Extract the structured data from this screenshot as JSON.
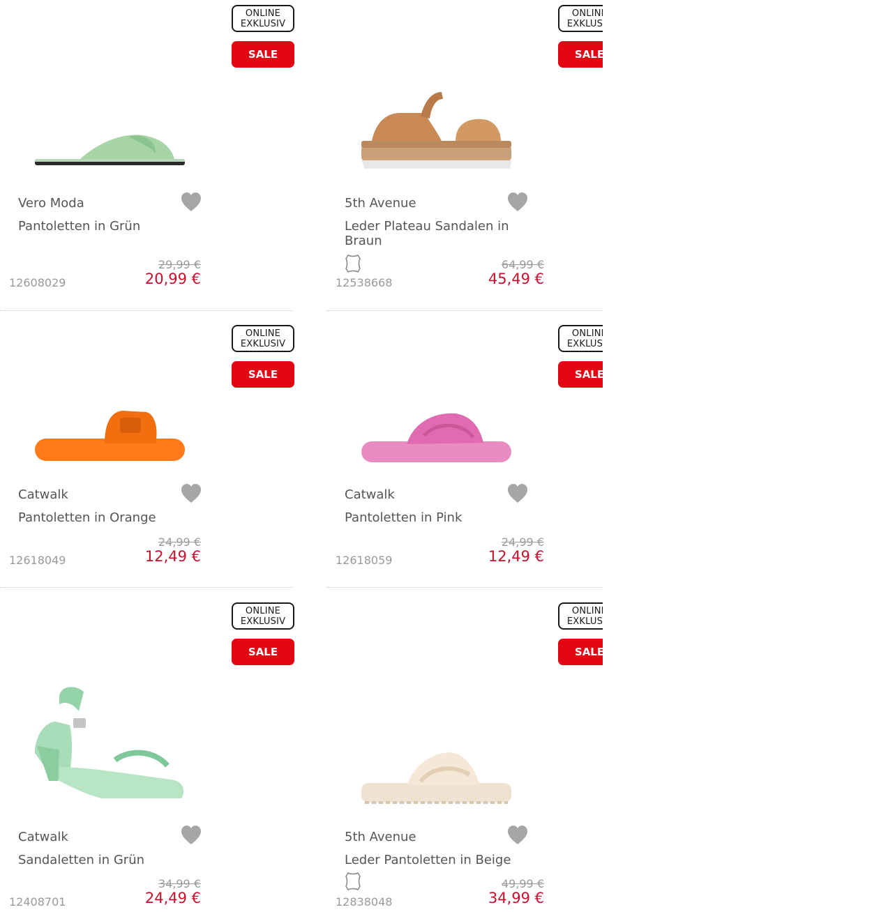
{
  "badges": {
    "online_line1": "ONLINE",
    "online_line2": "EXKLUSIV",
    "sale": "SALE"
  },
  "colors": {
    "sale_red": "#e30613",
    "price_red": "#c8102e",
    "text_gray": "#555555",
    "muted_gray": "#9a9a9a"
  },
  "products": [
    {
      "brand": "Vero Moda",
      "title": "Pantoletten in Grün",
      "old_price": "29,99 €",
      "new_price": "20,99 €",
      "sku": "12608029",
      "leather": false
    },
    {
      "brand": "5th Avenue",
      "title": "Leder Plateau Sandalen in Braun",
      "old_price": "64,99 €",
      "new_price": "45,49 €",
      "sku": "12538668",
      "leather": true
    },
    {
      "brand": "Catwalk",
      "title": "Pantoletten in Orange",
      "old_price": "24,99 €",
      "new_price": "12,49 €",
      "sku": "12618049",
      "leather": false
    },
    {
      "brand": "Catwalk",
      "title": "Pantoletten in Pink",
      "old_price": "24,99 €",
      "new_price": "12,49 €",
      "sku": "12618059",
      "leather": false
    },
    {
      "brand": "Catwalk",
      "title": "Sandaletten in Grün",
      "old_price": "34,99 €",
      "new_price": "24,49 €",
      "sku": "12408701",
      "leather": false
    },
    {
      "brand": "5th Avenue",
      "title": "Leder Pantoletten in Beige",
      "old_price": "49,99 €",
      "new_price": "34,99 €",
      "sku": "12838048",
      "leather": true
    }
  ],
  "icons": {
    "wishlist": "heart-icon",
    "material": "leather-icon"
  }
}
